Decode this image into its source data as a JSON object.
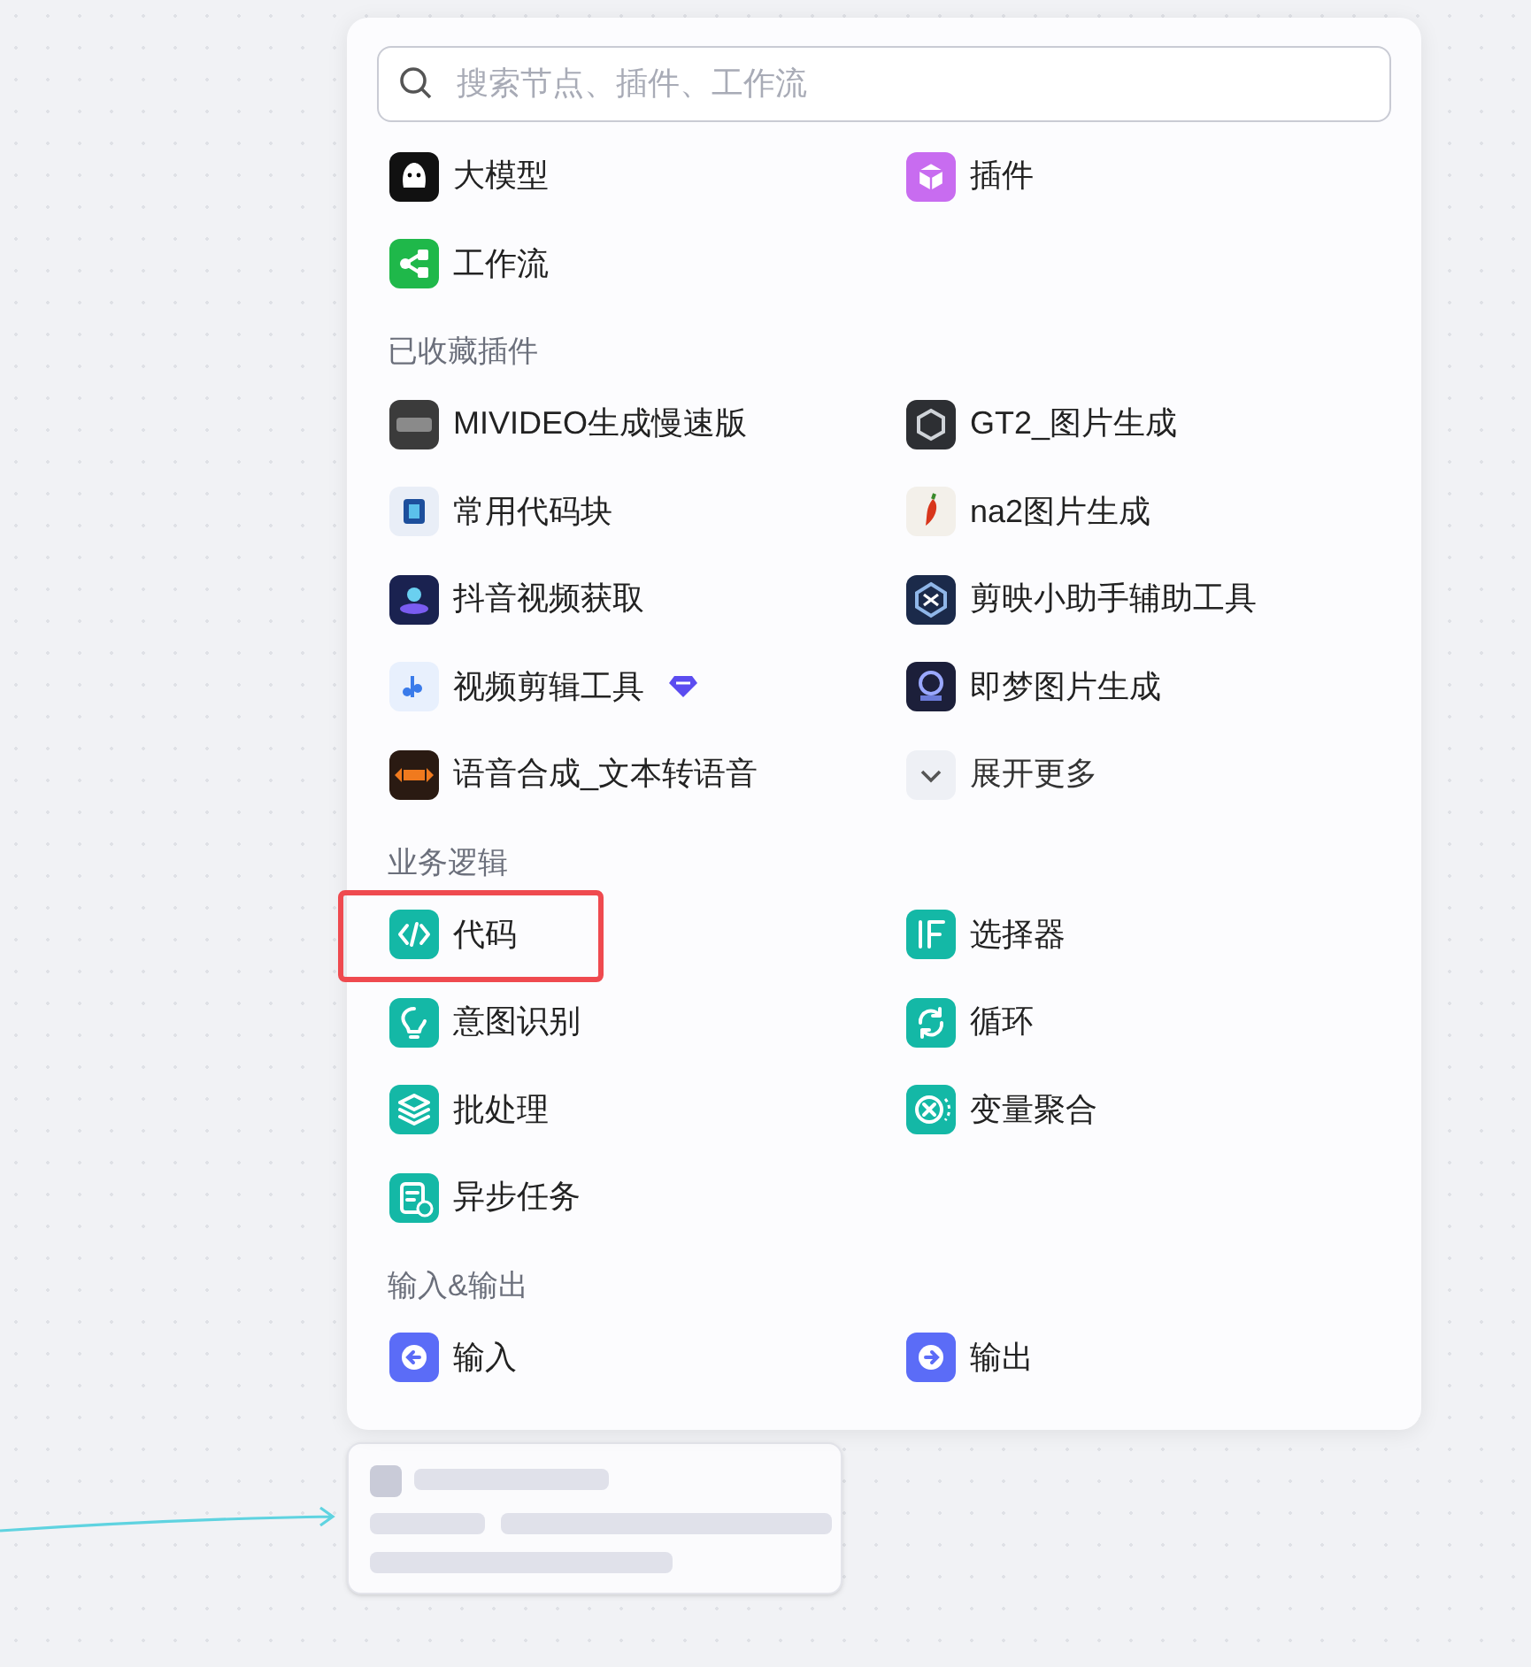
{
  "search": {
    "placeholder": "搜索节点、插件、工作流"
  },
  "sections": [
    {
      "items": [
        {
          "label": "大模型",
          "kind": "node"
        },
        {
          "label": "插件",
          "kind": "node"
        },
        {
          "label": "工作流",
          "kind": "node"
        }
      ]
    },
    {
      "title": "已收藏插件",
      "items": [
        {
          "label": "MIVIDEO生成慢速版",
          "kind": "plugin"
        },
        {
          "label": "GT2_图片生成",
          "kind": "plugin"
        },
        {
          "label": "常用代码块",
          "kind": "plugin"
        },
        {
          "label": "na2图片生成",
          "kind": "plugin"
        },
        {
          "label": "抖音视频获取",
          "kind": "plugin"
        },
        {
          "label": "剪映小助手辅助工具",
          "kind": "plugin"
        },
        {
          "label": "视频剪辑工具",
          "kind": "plugin",
          "premium": true
        },
        {
          "label": "即梦图片生成",
          "kind": "plugin"
        },
        {
          "label": "语音合成_文本转语音",
          "kind": "plugin"
        },
        {
          "label": "展开更多",
          "kind": "expand"
        }
      ]
    },
    {
      "title": "业务逻辑",
      "items": [
        {
          "label": "代码",
          "kind": "node",
          "highlighted": true
        },
        {
          "label": "选择器",
          "kind": "node"
        },
        {
          "label": "意图识别",
          "kind": "node"
        },
        {
          "label": "循环",
          "kind": "node"
        },
        {
          "label": "批处理",
          "kind": "node"
        },
        {
          "label": "变量聚合",
          "kind": "node"
        },
        {
          "label": "异步任务",
          "kind": "node"
        }
      ]
    },
    {
      "title": "输入&输出",
      "items": [
        {
          "label": "输入",
          "kind": "node"
        },
        {
          "label": "输出",
          "kind": "node"
        }
      ]
    }
  ]
}
